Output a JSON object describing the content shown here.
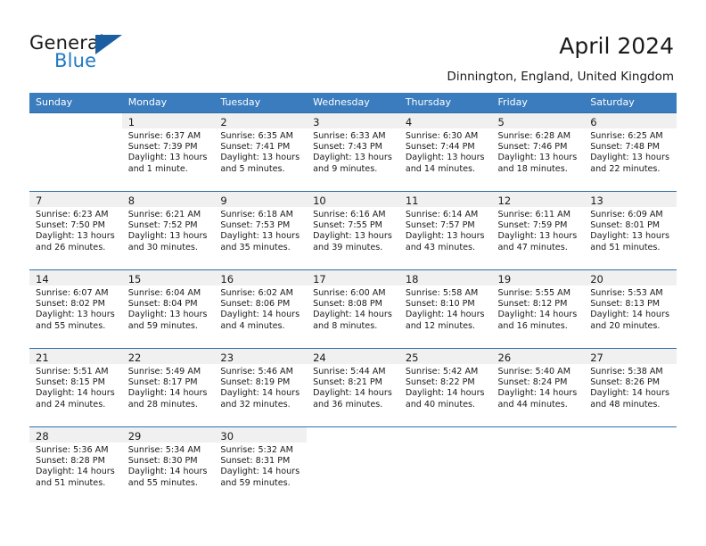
{
  "brand": {
    "word1": "General",
    "word2": "Blue",
    "accent_color": "#1f7ac4",
    "triangle_color": "#1c5fa0"
  },
  "header": {
    "title": "April 2024",
    "subtitle": "Dinnington, England, United Kingdom"
  },
  "calendar": {
    "header_bg": "#3a7cbe",
    "daynum_bg": "#f0f0f0",
    "weekdays": [
      "Sunday",
      "Monday",
      "Tuesday",
      "Wednesday",
      "Thursday",
      "Friday",
      "Saturday"
    ],
    "weeks": [
      [
        {
          "day": "",
          "empty": true
        },
        {
          "day": "1",
          "sunrise": "Sunrise: 6:37 AM",
          "sunset": "Sunset: 7:39 PM",
          "daylight1": "Daylight: 13 hours",
          "daylight2": "and 1 minute."
        },
        {
          "day": "2",
          "sunrise": "Sunrise: 6:35 AM",
          "sunset": "Sunset: 7:41 PM",
          "daylight1": "Daylight: 13 hours",
          "daylight2": "and 5 minutes."
        },
        {
          "day": "3",
          "sunrise": "Sunrise: 6:33 AM",
          "sunset": "Sunset: 7:43 PM",
          "daylight1": "Daylight: 13 hours",
          "daylight2": "and 9 minutes."
        },
        {
          "day": "4",
          "sunrise": "Sunrise: 6:30 AM",
          "sunset": "Sunset: 7:44 PM",
          "daylight1": "Daylight: 13 hours",
          "daylight2": "and 14 minutes."
        },
        {
          "day": "5",
          "sunrise": "Sunrise: 6:28 AM",
          "sunset": "Sunset: 7:46 PM",
          "daylight1": "Daylight: 13 hours",
          "daylight2": "and 18 minutes."
        },
        {
          "day": "6",
          "sunrise": "Sunrise: 6:25 AM",
          "sunset": "Sunset: 7:48 PM",
          "daylight1": "Daylight: 13 hours",
          "daylight2": "and 22 minutes."
        }
      ],
      [
        {
          "day": "7",
          "sunrise": "Sunrise: 6:23 AM",
          "sunset": "Sunset: 7:50 PM",
          "daylight1": "Daylight: 13 hours",
          "daylight2": "and 26 minutes."
        },
        {
          "day": "8",
          "sunrise": "Sunrise: 6:21 AM",
          "sunset": "Sunset: 7:52 PM",
          "daylight1": "Daylight: 13 hours",
          "daylight2": "and 30 minutes."
        },
        {
          "day": "9",
          "sunrise": "Sunrise: 6:18 AM",
          "sunset": "Sunset: 7:53 PM",
          "daylight1": "Daylight: 13 hours",
          "daylight2": "and 35 minutes."
        },
        {
          "day": "10",
          "sunrise": "Sunrise: 6:16 AM",
          "sunset": "Sunset: 7:55 PM",
          "daylight1": "Daylight: 13 hours",
          "daylight2": "and 39 minutes."
        },
        {
          "day": "11",
          "sunrise": "Sunrise: 6:14 AM",
          "sunset": "Sunset: 7:57 PM",
          "daylight1": "Daylight: 13 hours",
          "daylight2": "and 43 minutes."
        },
        {
          "day": "12",
          "sunrise": "Sunrise: 6:11 AM",
          "sunset": "Sunset: 7:59 PM",
          "daylight1": "Daylight: 13 hours",
          "daylight2": "and 47 minutes."
        },
        {
          "day": "13",
          "sunrise": "Sunrise: 6:09 AM",
          "sunset": "Sunset: 8:01 PM",
          "daylight1": "Daylight: 13 hours",
          "daylight2": "and 51 minutes."
        }
      ],
      [
        {
          "day": "14",
          "sunrise": "Sunrise: 6:07 AM",
          "sunset": "Sunset: 8:02 PM",
          "daylight1": "Daylight: 13 hours",
          "daylight2": "and 55 minutes."
        },
        {
          "day": "15",
          "sunrise": "Sunrise: 6:04 AM",
          "sunset": "Sunset: 8:04 PM",
          "daylight1": "Daylight: 13 hours",
          "daylight2": "and 59 minutes."
        },
        {
          "day": "16",
          "sunrise": "Sunrise: 6:02 AM",
          "sunset": "Sunset: 8:06 PM",
          "daylight1": "Daylight: 14 hours",
          "daylight2": "and 4 minutes."
        },
        {
          "day": "17",
          "sunrise": "Sunrise: 6:00 AM",
          "sunset": "Sunset: 8:08 PM",
          "daylight1": "Daylight: 14 hours",
          "daylight2": "and 8 minutes."
        },
        {
          "day": "18",
          "sunrise": "Sunrise: 5:58 AM",
          "sunset": "Sunset: 8:10 PM",
          "daylight1": "Daylight: 14 hours",
          "daylight2": "and 12 minutes."
        },
        {
          "day": "19",
          "sunrise": "Sunrise: 5:55 AM",
          "sunset": "Sunset: 8:12 PM",
          "daylight1": "Daylight: 14 hours",
          "daylight2": "and 16 minutes."
        },
        {
          "day": "20",
          "sunrise": "Sunrise: 5:53 AM",
          "sunset": "Sunset: 8:13 PM",
          "daylight1": "Daylight: 14 hours",
          "daylight2": "and 20 minutes."
        }
      ],
      [
        {
          "day": "21",
          "sunrise": "Sunrise: 5:51 AM",
          "sunset": "Sunset: 8:15 PM",
          "daylight1": "Daylight: 14 hours",
          "daylight2": "and 24 minutes."
        },
        {
          "day": "22",
          "sunrise": "Sunrise: 5:49 AM",
          "sunset": "Sunset: 8:17 PM",
          "daylight1": "Daylight: 14 hours",
          "daylight2": "and 28 minutes."
        },
        {
          "day": "23",
          "sunrise": "Sunrise: 5:46 AM",
          "sunset": "Sunset: 8:19 PM",
          "daylight1": "Daylight: 14 hours",
          "daylight2": "and 32 minutes."
        },
        {
          "day": "24",
          "sunrise": "Sunrise: 5:44 AM",
          "sunset": "Sunset: 8:21 PM",
          "daylight1": "Daylight: 14 hours",
          "daylight2": "and 36 minutes."
        },
        {
          "day": "25",
          "sunrise": "Sunrise: 5:42 AM",
          "sunset": "Sunset: 8:22 PM",
          "daylight1": "Daylight: 14 hours",
          "daylight2": "and 40 minutes."
        },
        {
          "day": "26",
          "sunrise": "Sunrise: 5:40 AM",
          "sunset": "Sunset: 8:24 PM",
          "daylight1": "Daylight: 14 hours",
          "daylight2": "and 44 minutes."
        },
        {
          "day": "27",
          "sunrise": "Sunrise: 5:38 AM",
          "sunset": "Sunset: 8:26 PM",
          "daylight1": "Daylight: 14 hours",
          "daylight2": "and 48 minutes."
        }
      ],
      [
        {
          "day": "28",
          "sunrise": "Sunrise: 5:36 AM",
          "sunset": "Sunset: 8:28 PM",
          "daylight1": "Daylight: 14 hours",
          "daylight2": "and 51 minutes."
        },
        {
          "day": "29",
          "sunrise": "Sunrise: 5:34 AM",
          "sunset": "Sunset: 8:30 PM",
          "daylight1": "Daylight: 14 hours",
          "daylight2": "and 55 minutes."
        },
        {
          "day": "30",
          "sunrise": "Sunrise: 5:32 AM",
          "sunset": "Sunset: 8:31 PM",
          "daylight1": "Daylight: 14 hours",
          "daylight2": "and 59 minutes."
        },
        {
          "day": "",
          "empty": true
        },
        {
          "day": "",
          "empty": true
        },
        {
          "day": "",
          "empty": true
        },
        {
          "day": "",
          "empty": true
        }
      ]
    ]
  }
}
